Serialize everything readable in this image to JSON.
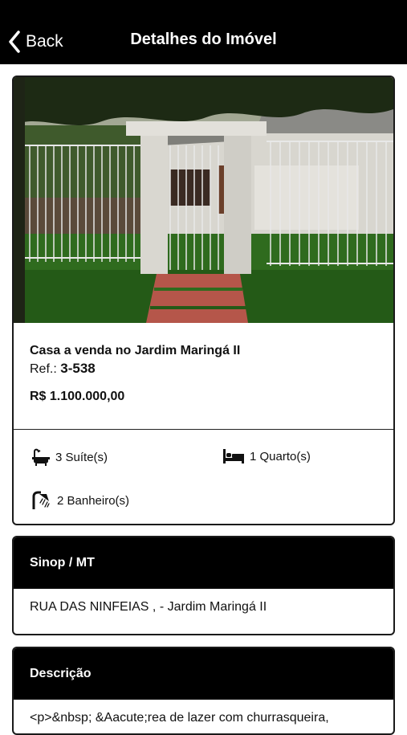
{
  "nav": {
    "back_label": "Back",
    "title": "Detalhes do Imóvel"
  },
  "listing": {
    "title": "Casa a venda no Jardim Maringá II",
    "ref_label": "Ref.:",
    "ref_value": "3-538",
    "price": "R$ 1.100.000,00",
    "features": {
      "suites": "3 Suíte(s)",
      "quartos": "1 Quarto(s)",
      "banheiros": "2 Banheiro(s)"
    }
  },
  "location": {
    "heading": "Sinop / MT",
    "address": "RUA DAS NINFEIAS , - Jardim Maringá II"
  },
  "description": {
    "heading": "Descrição",
    "text": "<p>&nbsp; &Aacute;rea de lazer com churrasqueira,"
  },
  "icons": {
    "back": "chevron-left-icon",
    "suites": "bathtub-icon",
    "quartos": "bed-icon",
    "banheiros": "shower-icon"
  },
  "colors": {
    "header": "#000000",
    "text": "#111111",
    "card_border": "#1a1a1a"
  }
}
